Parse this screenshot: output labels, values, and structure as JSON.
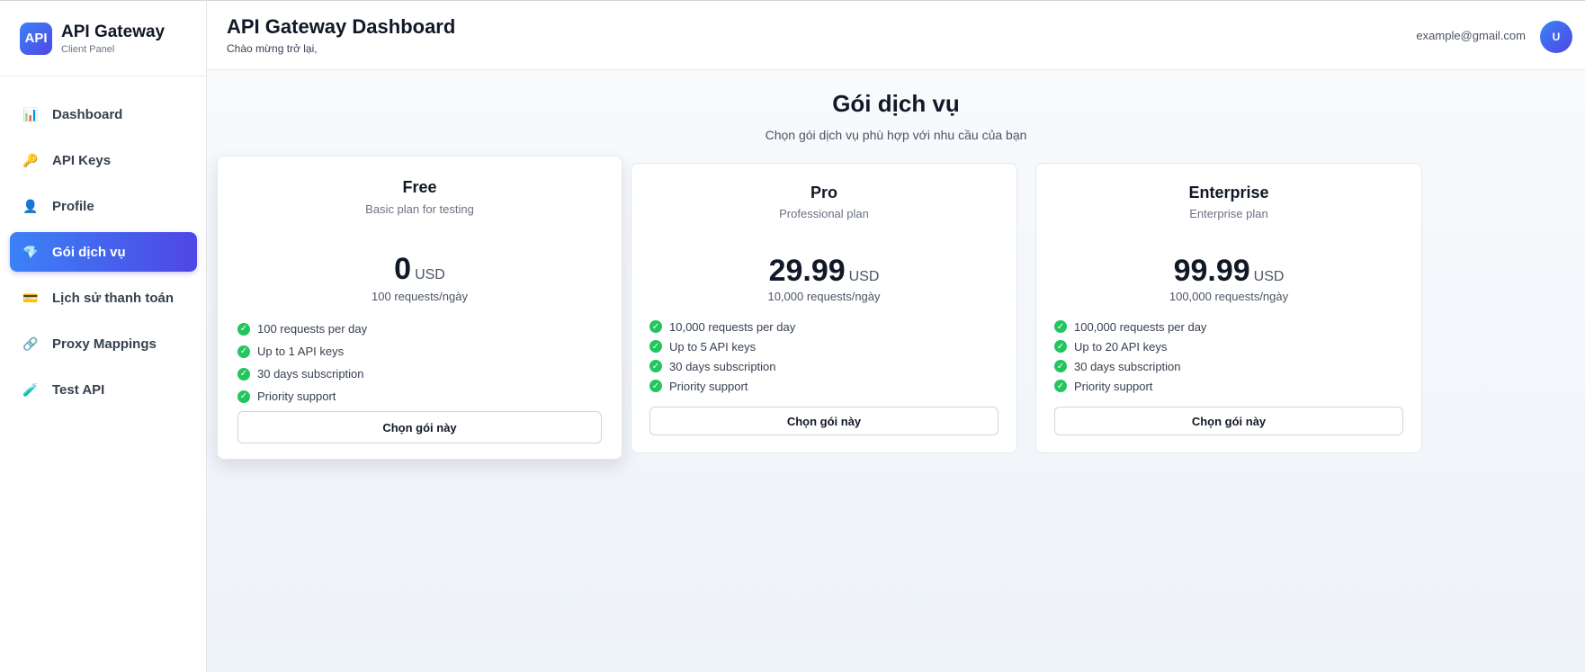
{
  "brand": {
    "logo": "API",
    "title": "API Gateway",
    "subtitle": "Client Panel"
  },
  "sidebar": {
    "items": [
      {
        "label": "Dashboard",
        "icon": "bar-chart-icon",
        "glyph": "📊",
        "active": false
      },
      {
        "label": "API Keys",
        "icon": "key-icon",
        "glyph": "🔑",
        "active": false
      },
      {
        "label": "Profile",
        "icon": "user-icon",
        "glyph": "👤",
        "active": false
      },
      {
        "label": "Gói dịch vụ",
        "icon": "gem-icon",
        "glyph": "💎",
        "active": true
      },
      {
        "label": "Lịch sử thanh toán",
        "icon": "credit-card-icon",
        "glyph": "💳",
        "active": false
      },
      {
        "label": "Proxy Mappings",
        "icon": "link-icon",
        "glyph": "🔗",
        "active": false
      },
      {
        "label": "Test API",
        "icon": "test-tube-icon",
        "glyph": "🧪",
        "active": false
      }
    ]
  },
  "header": {
    "title": "API Gateway Dashboard",
    "welcome": "Chào mừng trở lại,",
    "email": "example@gmail.com",
    "avatar": "U"
  },
  "main": {
    "title": "Gói dịch vụ",
    "subtitle": "Chọn gói dịch vụ phù hợp với nhu cầu của bạn",
    "plans": [
      {
        "name": "Free",
        "description": "Basic plan for testing",
        "price": "0",
        "currency": "USD",
        "requests": "100 requests/ngày",
        "features": [
          "100 requests per day",
          "Up to 1 API keys",
          "30 days subscription",
          "Priority support"
        ],
        "button": "Chọn gói này"
      },
      {
        "name": "Pro",
        "description": "Professional plan",
        "price": "29.99",
        "currency": "USD",
        "requests": "10,000 requests/ngày",
        "features": [
          "10,000 requests per day",
          "Up to 5 API keys",
          "30 days subscription",
          "Priority support"
        ],
        "button": "Chọn gói này"
      },
      {
        "name": "Enterprise",
        "description": "Enterprise plan",
        "price": "99.99",
        "currency": "USD",
        "requests": "100,000 requests/ngày",
        "features": [
          "100,000 requests per day",
          "Up to 20 API keys",
          "30 days subscription",
          "Priority support"
        ],
        "button": "Chọn gói này"
      }
    ]
  },
  "colors": {
    "accent_start": "#3b82f6",
    "accent_end": "#4f46e5",
    "check": "#22c55e"
  }
}
